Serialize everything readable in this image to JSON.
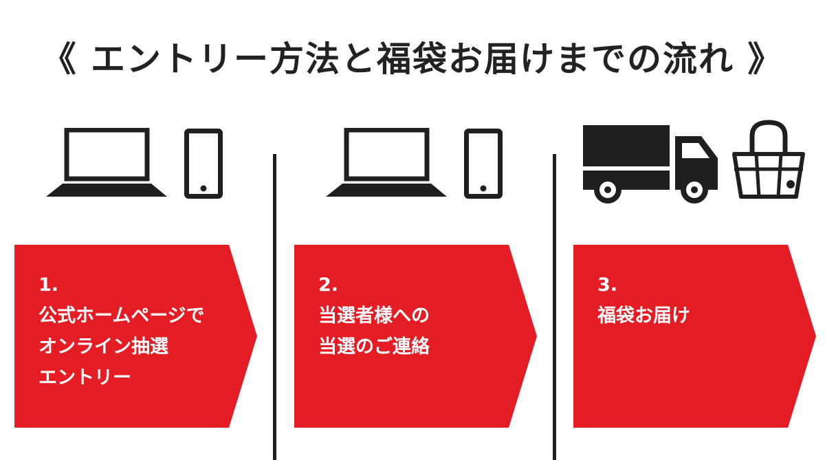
{
  "title": "《 エントリー方法と福袋お届けまでの流れ 》",
  "steps": [
    {
      "number": "1.",
      "lines": [
        "公式ホームページで",
        "オンライン抽選",
        "エントリー"
      ]
    },
    {
      "number": "2.",
      "lines": [
        "当選者様への",
        "当選のご連絡"
      ]
    },
    {
      "number": "3.",
      "lines": [
        "福袋お届け"
      ]
    }
  ],
  "colors": {
    "accent": "#e41d25",
    "ink": "#1f1f1f"
  },
  "icons": [
    "laptop-icon",
    "smartphone-icon",
    "truck-icon",
    "bag-icon"
  ]
}
